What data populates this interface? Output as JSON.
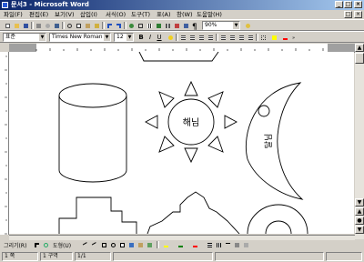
{
  "window": {
    "title": "문서3 - Microsoft Word"
  },
  "menu": [
    "파일(F)",
    "편집(E)",
    "보기(V)",
    "삽입(I)",
    "서식(O)",
    "도구(T)",
    "표(A)",
    "창(W)",
    "도움말(H)"
  ],
  "toolbar": {
    "zoom": "90%"
  },
  "format": {
    "style": "표준",
    "font": "Times New Roman",
    "size": "12"
  },
  "shapes": {
    "sun_label": "해님",
    "moon_label": "달님"
  },
  "drawing": {
    "draw_label": "그리기(R)",
    "autoshape_label": "도형(U)"
  },
  "status": {
    "page": "1 쪽",
    "section": "1 구역",
    "pages": "1/1"
  },
  "colors": {
    "titlebar": "#0a246a",
    "fill_color": "#ffff00",
    "line_color": "#008000",
    "font_color": "#ff0000"
  }
}
